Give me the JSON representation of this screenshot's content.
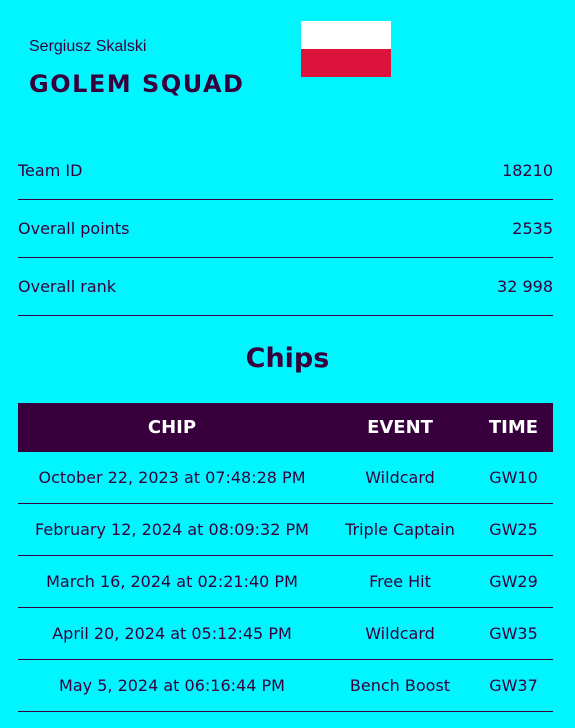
{
  "header": {
    "manager_name": "Sergiusz Skalski",
    "team_name": "GOLEM SQUAD",
    "flag": {
      "country": "Poland",
      "top_color": "#ffffff",
      "bottom_color": "#dc143c"
    }
  },
  "stats": [
    {
      "label": "Team ID",
      "value": "18210"
    },
    {
      "label": "Overall points",
      "value": "2535"
    },
    {
      "label": "Overall rank",
      "value": "32 998"
    }
  ],
  "chips": {
    "title": "Chips",
    "columns": [
      "CHIP",
      "EVENT",
      "TIME"
    ],
    "rows": [
      {
        "date": "October 22, 2023 at 07:48:28 PM",
        "event": "Wildcard",
        "gw": "GW10"
      },
      {
        "date": "February 12, 2024 at 08:09:32 PM",
        "event": "Triple Captain",
        "gw": "GW25"
      },
      {
        "date": "March 16, 2024 at 02:21:40 PM",
        "event": "Free Hit",
        "gw": "GW29"
      },
      {
        "date": "April 20, 2024 at 05:12:45 PM",
        "event": "Wildcard",
        "gw": "GW35"
      },
      {
        "date": "May 5, 2024 at 06:16:44 PM",
        "event": "Bench Boost",
        "gw": "GW37"
      }
    ]
  },
  "colors": {
    "background": "#00f5ff",
    "primary": "#37003c",
    "header_text": "#ffffff"
  }
}
